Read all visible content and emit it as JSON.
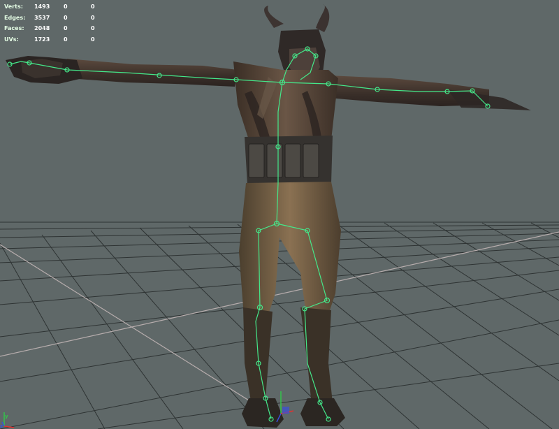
{
  "heads_up_display": {
    "rows": [
      {
        "label": "Verts:",
        "total": "1493",
        "selected": "0",
        "uv": "0"
      },
      {
        "label": "Edges:",
        "total": "3537",
        "selected": "0",
        "uv": "0"
      },
      {
        "label": "Faces:",
        "total": "2048",
        "selected": "0",
        "uv": "0"
      },
      {
        "label": "UVs:",
        "total": "1723",
        "selected": "0",
        "uv": "0"
      }
    ]
  },
  "view_axis": {
    "y_label": "y",
    "z_label": "z"
  },
  "colors": {
    "viewport_background": "#5f6868",
    "grid_line": "#2e3333",
    "grid_axis": "#b7adad",
    "skeleton_joint": "#44e88a",
    "axis_x": "#e33030",
    "axis_y": "#33c44a",
    "axis_z": "#3a4fdc"
  },
  "icons": {
    "scene_view": "perspective-viewport-icon",
    "skeleton": "bone-joint-icon",
    "view_axis": "xyz-axis-gizmo-icon"
  }
}
